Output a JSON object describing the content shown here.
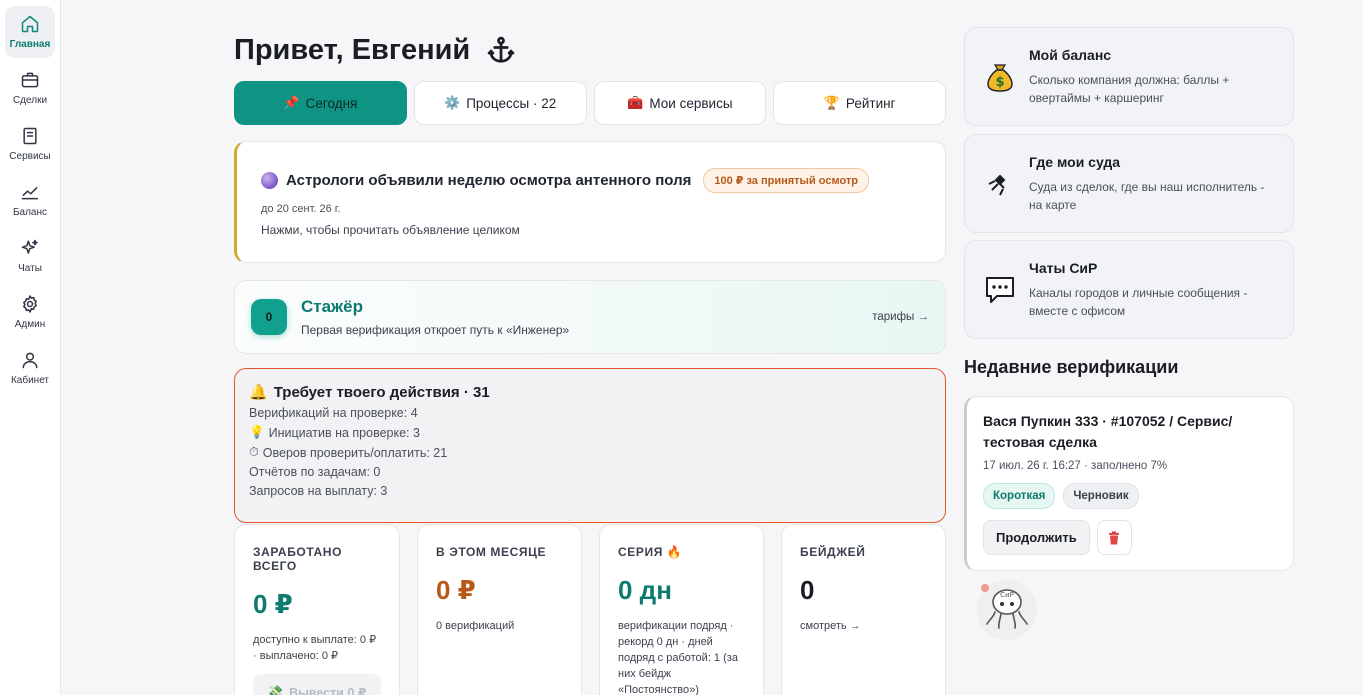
{
  "sidebar": {
    "items": [
      {
        "label": "Главная",
        "icon": "home-icon",
        "active": true
      },
      {
        "label": "Сделки",
        "icon": "briefcase-icon"
      },
      {
        "label": "Сервисы",
        "icon": "book-icon"
      },
      {
        "label": "Баланс",
        "icon": "chart-line-icon"
      },
      {
        "label": "Чаты",
        "icon": "sparkle-icon"
      },
      {
        "label": "Админ",
        "icon": "gear-icon"
      },
      {
        "label": "Кабинет",
        "icon": "user-icon"
      }
    ]
  },
  "header": {
    "greeting": "Привет, Евгений",
    "emoji": "⚓"
  },
  "tabs": [
    {
      "label": "Сегодня",
      "icon": "📌",
      "active": true
    },
    {
      "label": "Процессы · 22",
      "icon": "⚙️"
    },
    {
      "label": "Мои сервисы",
      "icon": "🧰"
    },
    {
      "label": "Рейтинг",
      "icon": "🏆"
    }
  ],
  "announcement": {
    "title": "Астрологи объявили неделю осмотра антенного поля",
    "reward": "100 ₽ за принятый осмотр",
    "date": "до 20 сент. 26 г.",
    "hint": "Нажми, чтобы прочитать объявление целиком"
  },
  "rank": {
    "level": "0",
    "title": "Стажёр",
    "subtitle": "Первая верификация откроет путь к «Инженер»",
    "link": "тарифы →"
  },
  "action_required": {
    "title": "Требует твоего действия · 31",
    "lines": [
      {
        "text": "Верификаций на проверке: 4",
        "icon": ""
      },
      {
        "text": "Инициатив на проверке: 3",
        "icon": "💡"
      },
      {
        "text": "Оверов проверить/оплатить: 21",
        "icon": "⏱"
      },
      {
        "text": "Отчётов по задачам: 0",
        "icon": ""
      },
      {
        "text": "Запросов на выплату: 3",
        "icon": ""
      }
    ]
  },
  "stats": [
    {
      "label": "ЗАРАБОТАНО ВСЕГО",
      "value": "0 ₽",
      "note": "доступно к выплате: 0 ₽ · выплачено: 0 ₽",
      "button": "Вывести 0 ₽",
      "color": "#0e7a6e"
    },
    {
      "label": "В ЭТОМ МЕСЯЦЕ",
      "value": "0 ₽",
      "note": "0 верификаций",
      "color": "#b8591a"
    },
    {
      "label": "СЕРИЯ 🔥",
      "value": "0 дн",
      "note": "верификации подряд · рекорд 0 дн · дней подряд с работой: 1 (за них бейдж «Постоянство»)",
      "color": "#0e7a6e"
    },
    {
      "label": "БЕЙДЖЕЙ",
      "value": "0",
      "note": "смотреть →",
      "color": "#1a1d24"
    }
  ],
  "side_cards": [
    {
      "title": "Мой баланс",
      "subtitle": "Сколько компания должна: баллы + овертаймы + каршеринг",
      "icon": "money-bag-icon"
    },
    {
      "title": "Где мои суда",
      "subtitle": "Суда из сделок, где вы наш исполнитель - на карте",
      "icon": "satellite-icon"
    },
    {
      "title": "Чаты СиР",
      "subtitle": "Каналы городов и личные сообщения - вместе с офисом",
      "icon": "chat-bubble-icon"
    }
  ],
  "recent": {
    "heading": "Недавние верификации",
    "title": "Вася Пупкин 333 · #107052 / Сервис/ тестовая сделка",
    "meta": "17 июл. 26 г. 16:27 · заполнено 7%",
    "tags": [
      "Короткая",
      "Черновик"
    ],
    "continue": "Продолжить"
  },
  "mascot_label": "СиР",
  "colors": {
    "accent": "#0f9483",
    "warning_border": "#e35a2a",
    "announce_border": "#d4a72c"
  }
}
